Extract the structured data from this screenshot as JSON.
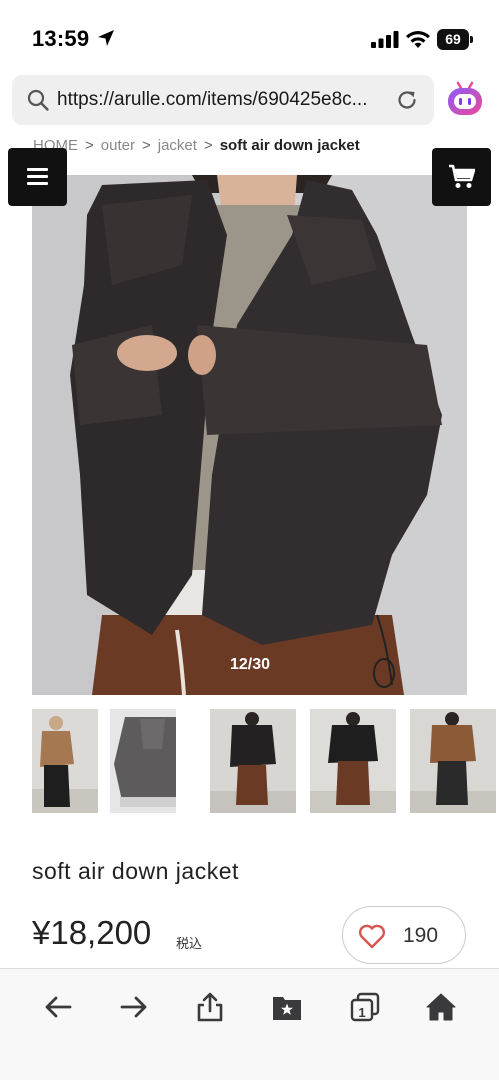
{
  "status_bar": {
    "time": "13:59",
    "battery": "69",
    "icons": [
      "location-arrow-icon",
      "signal-icon",
      "wifi-icon",
      "battery-icon"
    ]
  },
  "browser": {
    "url": "https://arulle.com/items/690425e8c...",
    "icons": [
      "search-icon",
      "reload-icon",
      "assistant-icon"
    ]
  },
  "breadcrumb": {
    "items": [
      "HOME",
      "outer",
      "jacket"
    ],
    "current": "soft air down jacket",
    "separator": ">"
  },
  "header": {
    "icons": [
      "menu-icon",
      "cart-icon"
    ]
  },
  "gallery": {
    "counter": "12/30",
    "thumbnail_count": 5
  },
  "product": {
    "title": "soft air down jacket",
    "price": "¥18,200",
    "tax_label": "税込",
    "like_count": "190"
  },
  "toolbar": {
    "icons": [
      "back-icon",
      "forward-icon",
      "share-icon",
      "bookmarks-icon",
      "tabs-icon",
      "home-icon"
    ],
    "tabs_count": "1"
  },
  "colors": {
    "dark_button": "#111111",
    "heart": "#d9534f",
    "assistant_gradient": [
      "#8b5cf6",
      "#ec4899"
    ]
  }
}
